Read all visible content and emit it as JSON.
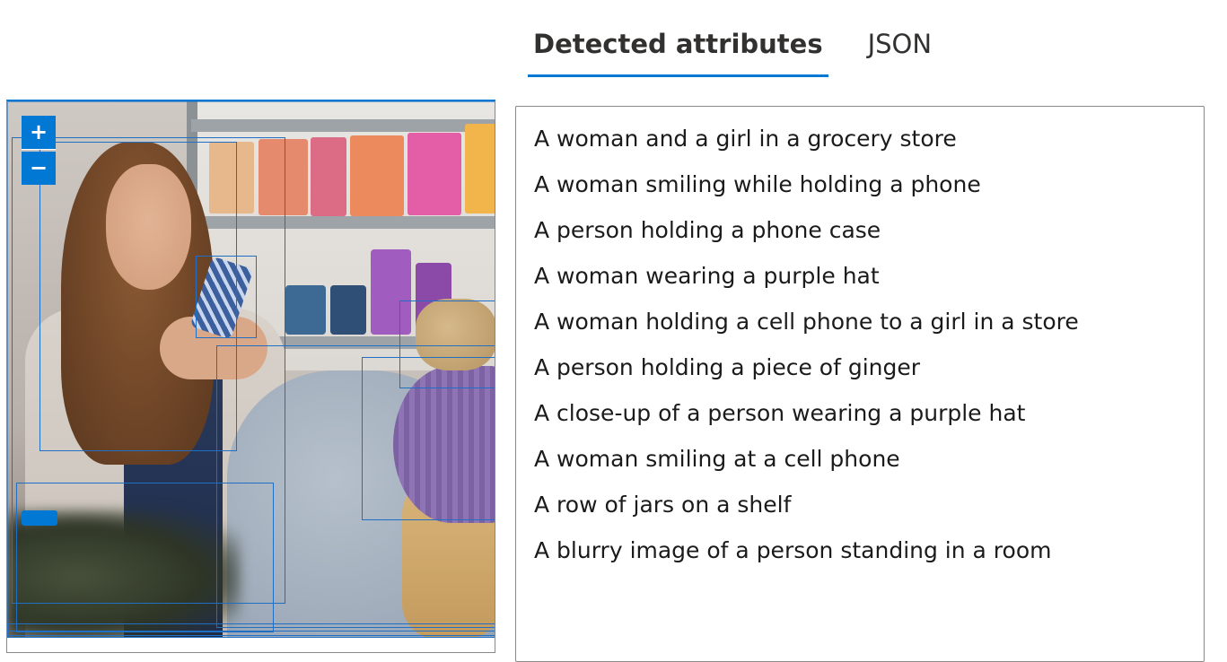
{
  "tabs": [
    {
      "label": "Detected attributes",
      "active": true
    },
    {
      "label": "JSON",
      "active": false
    }
  ],
  "viewer": {
    "zoom_in_label": "+",
    "zoom_out_label": "−"
  },
  "attributes": [
    "A woman and a girl in a grocery store",
    "A woman smiling while holding a phone",
    "A person holding a phone case",
    "A woman wearing a purple hat",
    "A woman holding a cell phone to a girl in a store",
    "A person holding a piece of ginger",
    "A close-up of a person wearing a purple hat",
    "A woman smiling at a cell phone",
    "A row of jars on a shelf",
    "A blurry image of a person standing in a room"
  ],
  "colors": {
    "accent": "#0078d4",
    "box_outline": "#1f6fc4",
    "panel_border": "#8a8886"
  }
}
